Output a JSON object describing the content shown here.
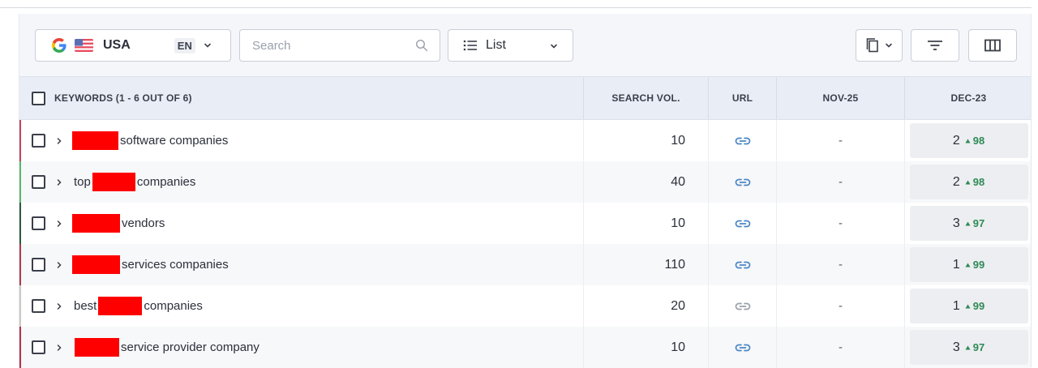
{
  "toolbar": {
    "region": {
      "engine_icon": "google-g-icon",
      "flag_icon": "us-flag-icon",
      "label": "USA",
      "language": "EN"
    },
    "search": {
      "placeholder": "Search",
      "value": ""
    },
    "view": {
      "label": "List",
      "icon": "list-icon"
    },
    "actions": [
      {
        "name": "copy-button",
        "icon": "copy-icon"
      },
      {
        "name": "filter-button",
        "icon": "filter-icon"
      },
      {
        "name": "columns-button",
        "icon": "columns-icon"
      }
    ]
  },
  "table": {
    "headers": {
      "keywords": "KEYWORDS (1 - 6 OUT OF 6)",
      "search_vol": "SEARCH VOL.",
      "url": "URL",
      "nov": "NOV-25",
      "dec": "DEC-23"
    },
    "rows": [
      {
        "prefix": "",
        "suffix": "software companies",
        "accent": "#c0475b",
        "volume": "10",
        "url_active": true,
        "nov": "-",
        "dec_position": "2",
        "dec_change": "98"
      },
      {
        "prefix": "top",
        "suffix": "companies",
        "accent": "#5ab86b",
        "volume": "40",
        "url_active": true,
        "nov": "-",
        "dec_position": "2",
        "dec_change": "98"
      },
      {
        "prefix": "",
        "suffix": "vendors",
        "accent": "#2c5a3c",
        "volume": "10",
        "url_active": true,
        "nov": "-",
        "dec_position": "3",
        "dec_change": "97"
      },
      {
        "prefix": "",
        "suffix": "services companies",
        "accent": "#b23b4d",
        "volume": "110",
        "url_active": true,
        "nov": "-",
        "dec_position": "1",
        "dec_change": "99"
      },
      {
        "prefix": "best",
        "suffix": "companies",
        "accent": "#cfc8bf",
        "volume": "20",
        "url_active": false,
        "nov": "-",
        "dec_position": "1",
        "dec_change": "99"
      },
      {
        "prefix": "",
        "suffix": "service provider company",
        "accent": "#b8324a",
        "volume": "10",
        "url_active": true,
        "nov": "-",
        "dec_position": "3",
        "dec_change": "97"
      }
    ]
  },
  "colors": {
    "link_active": "#4a86c5",
    "link_inactive": "#9aa0ab",
    "change_up": "#2e8a55",
    "redaction": "#ff0000"
  }
}
